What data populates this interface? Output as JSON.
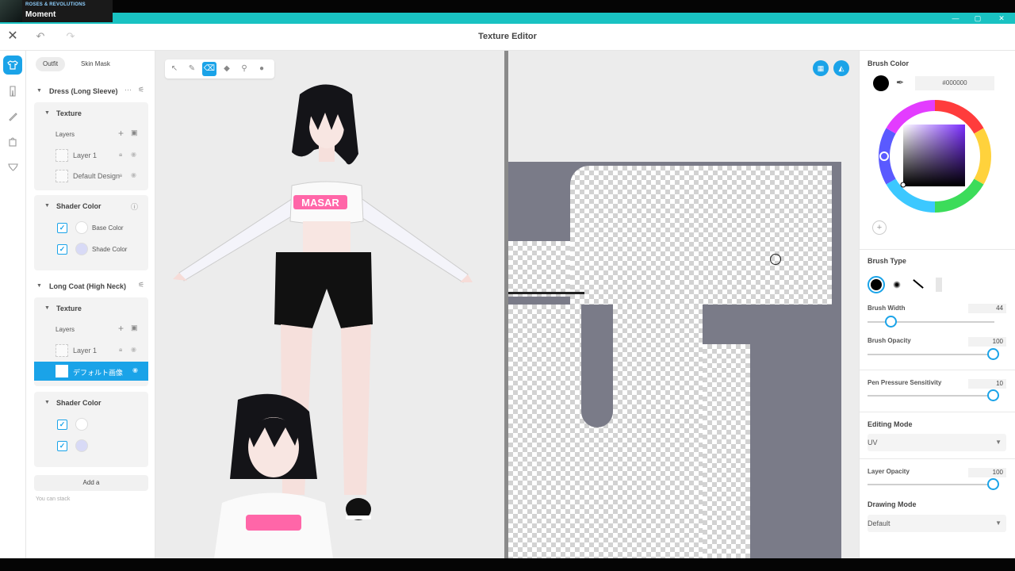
{
  "now_playing": {
    "artist": "ROSES & REVOLUTIONS",
    "song": "Moment"
  },
  "window": {
    "minimize": "—",
    "maximize": "▢",
    "close": "✕"
  },
  "header": {
    "title": "Texture Editor",
    "close_icon": "✕",
    "undo_icon": "↶",
    "redo_icon": "↷"
  },
  "rail": {
    "items": [
      "shirt-icon",
      "bottoms-icon",
      "brush-icon",
      "bag-icon",
      "underwear-icon"
    ]
  },
  "panel": {
    "tabs": [
      "Outfit",
      "Skin Mask"
    ],
    "groups": [
      {
        "name": "Dress (Long Sleeve)",
        "texture_label": "Texture",
        "layers_label": "Layers",
        "layers": [
          "Layer 1",
          "Default Design"
        ],
        "shader_label": "Shader Color",
        "shader_rows": [
          "Base Color",
          "Shade Color"
        ]
      },
      {
        "name": "Long Coat (High Neck)",
        "texture_label": "Texture",
        "layers_label": "Layers",
        "layers": [
          "Layer 1",
          "デフォルト画像"
        ],
        "shader_label": "Shader Color"
      }
    ],
    "add_button": "Add a",
    "hint": "You can stack"
  },
  "tools": [
    "select-tool",
    "pen-tool",
    "eraser-tool",
    "fill-tool",
    "picker-tool",
    "drop-tool"
  ],
  "props": {
    "brush_color_label": "Brush Color",
    "hex": "#000000",
    "brush_type_label": "Brush Type",
    "brush_width_label": "Brush Width",
    "brush_width": 44,
    "brush_opacity_label": "Brush Opacity",
    "brush_opacity": 100,
    "pressure_label": "Pen Pressure Sensitivity",
    "pressure": 10,
    "editing_mode_label": "Editing Mode",
    "editing_mode": "UV",
    "layer_opacity_label": "Layer Opacity",
    "layer_opacity": 100,
    "drawing_mode_label": "Drawing Mode",
    "drawing_mode": "Default"
  },
  "avatar_shirt_text": "MASAR",
  "colors": {
    "accent": "#1aa3e8",
    "titlebar": "#19c2c2",
    "shade_swatch": "#d8daf6"
  }
}
